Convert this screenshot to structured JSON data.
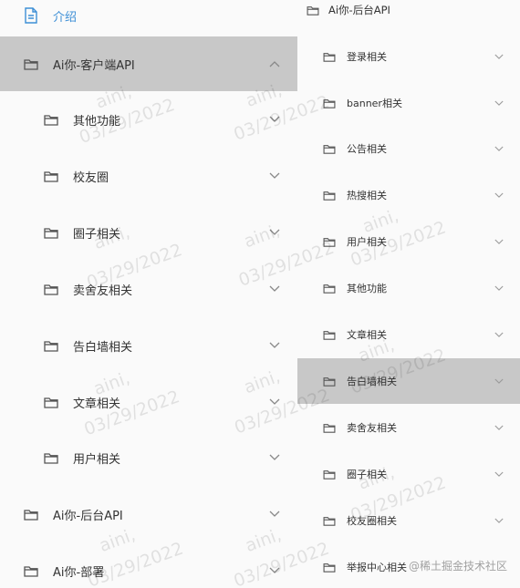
{
  "left_panel": {
    "intro_label": "介绍",
    "client_api": {
      "label": "Ai你-客户端API",
      "children": [
        "其他功能",
        "校友圈",
        "圈子相关",
        "卖舍友相关",
        "告白墙相关",
        "文章相关",
        "用户相关"
      ]
    },
    "admin_api_label": "Ai你-后台API",
    "deploy_label": "Ai你-部署"
  },
  "right_panel": {
    "header_label": "Ai你-后台API",
    "items": [
      "登录相关",
      "banner相关",
      "公告相关",
      "热搜相关",
      "用户相关",
      "其他功能",
      "文章相关",
      "告白墙相关",
      "卖舍友相关",
      "圈子相关",
      "校友圈相关",
      "举报中心相关"
    ],
    "selected": "告白墙相关"
  },
  "watermark": {
    "name": "aini,",
    "date": "03/29/2022"
  },
  "credit": "@稀土掘金技术社区",
  "colors": {
    "active_row": "#c8c8c8",
    "intro_link": "#3d8fd6",
    "text": "#333333",
    "icon_stroke": "#555555"
  }
}
